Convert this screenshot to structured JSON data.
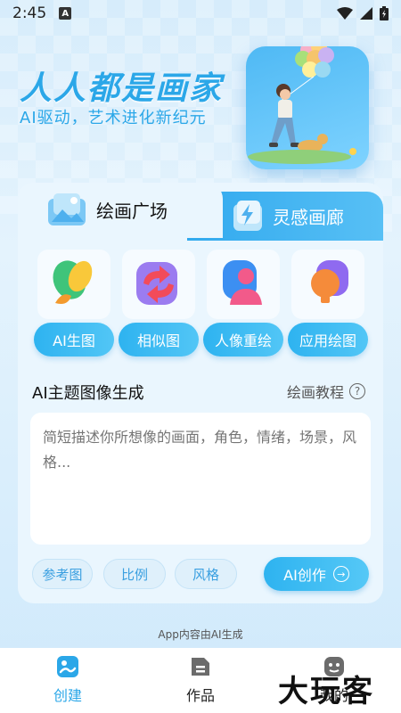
{
  "status_bar": {
    "time": "2:45",
    "notification_letter": "A"
  },
  "hero": {
    "title": "人人都是画家",
    "subtitle": "AI驱动，艺术进化新纪元"
  },
  "tabs": [
    {
      "label": "绘画广场",
      "active": true
    },
    {
      "label": "灵感画廊",
      "active": false
    }
  ],
  "tools": [
    {
      "label": "AI生图",
      "icon": "feather-brush-icon"
    },
    {
      "label": "相似图",
      "icon": "refresh-arrows-icon"
    },
    {
      "label": "人像重绘",
      "icon": "person-icon"
    },
    {
      "label": "应用绘图",
      "icon": "bulb-icon"
    }
  ],
  "section": {
    "title": "AI主题图像生成",
    "tutorial_label": "绘画教程",
    "help_glyph": "?"
  },
  "prompt": {
    "placeholder": "简短描述你所想像的画面，角色，情绪，场景，风格...",
    "value": ""
  },
  "chips": {
    "reference": "参考图",
    "ratio": "比例",
    "style": "风格"
  },
  "create_button": {
    "label": "AI创作",
    "arrow_glyph": "→"
  },
  "ai_note": "App内容由AI生成",
  "bottom_nav": [
    {
      "label": "创建",
      "active": true,
      "icon": "create-icon"
    },
    {
      "label": "作品",
      "active": false,
      "icon": "works-icon"
    },
    {
      "label": "我的",
      "active": false,
      "icon": "profile-icon"
    }
  ],
  "watermark": "大玩客",
  "colors": {
    "accent": "#2ba7e8",
    "accent_gradient_start": "#2eb3f0",
    "accent_gradient_end": "#55c8f6",
    "card_bg": "#eaf6fe"
  }
}
